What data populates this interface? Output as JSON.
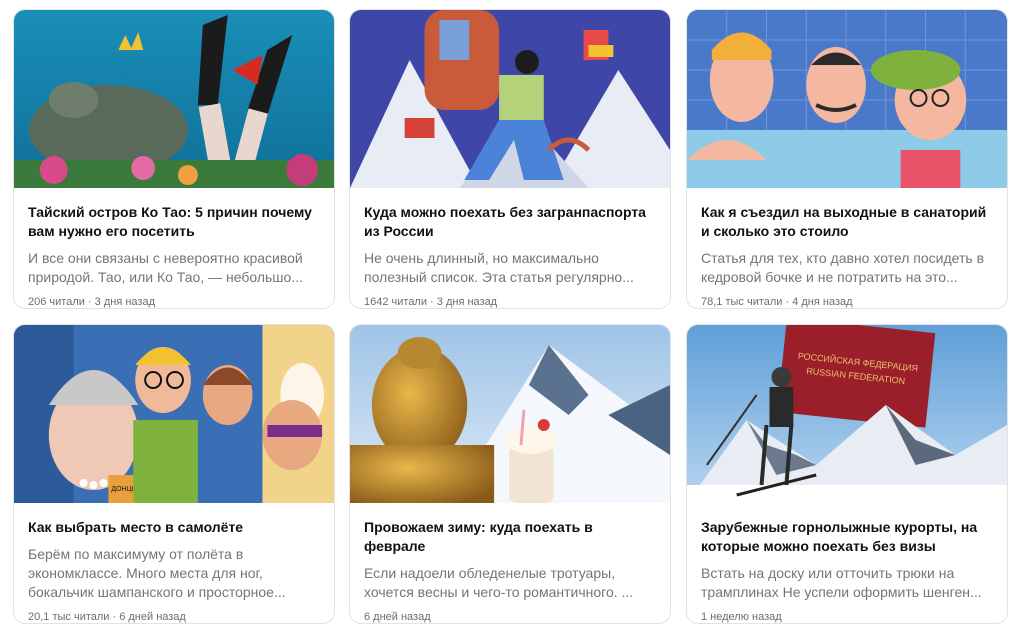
{
  "cards": [
    {
      "title": "Тайский остров Ко Тао: 5 причин почему вам нужно его посетить",
      "desc": "И все они связаны с невероятно красивой\nприродой. Тао, или Ко Тао, — небольшо...",
      "meta": "206 читали · 3 дня назад",
      "image": "turtle-diver-image"
    },
    {
      "title": "Куда можно поехать без загранпаспорта из России",
      "desc": "Не очень длинный, но максимально\nполезный список. Эта статья регулярно...",
      "meta": "1642 читали · 3 дня назад",
      "image": "backpacker-mountains-image"
    },
    {
      "title": "Как я съездил на выходные в санаторий и сколько это стоило",
      "desc": "Статья для тех, кто давно хотел посидеть в\nкедровой бочке и не потратить на это...",
      "meta": "78,1 тыс читали · 4 дня назад",
      "image": "pool-swimmers-image"
    },
    {
      "title": "Как выбрать место в самолёте",
      "desc": "Берём по максимуму от полёта в\nэкономклассе. Много места для ног,\nбокальчик шампанского и просторное...",
      "meta": "20,1 тыс читали · 6 дней назад",
      "image": "airplane-passengers-image",
      "book_label": "ДОНЦОВА"
    },
    {
      "title": "Провожаем зиму: куда поехать в феврале",
      "desc": "Если надоели обледенелые тротуары,\nхочется весны и чего-то романтичного. ...",
      "meta": "6 дней назад",
      "image": "buddha-mountains-image"
    },
    {
      "title": "Зарубежные горнолыжные курорты, на которые можно поехать без визы",
      "desc": "Встать на доску или отточить трюки на\nтрамплинах Не успели оформить шенген...",
      "meta": "1 неделю назад",
      "image": "skier-passport-image",
      "passport_label_1": "РОССИЙСКАЯ ФЕДЕРАЦИЯ",
      "passport_label_2": "RUSSIAN FEDERATION"
    }
  ],
  "colors": {
    "title": "#111111",
    "desc": "#757575",
    "meta": "#6d6d6d",
    "border": "#e3e3e3"
  }
}
